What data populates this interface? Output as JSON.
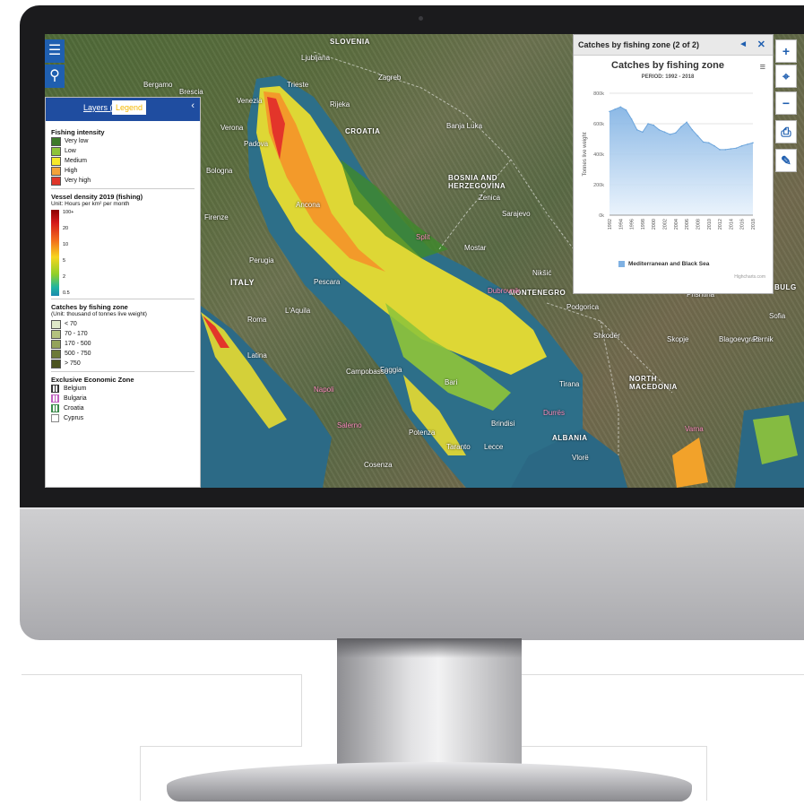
{
  "toolbar": {
    "menu_icon": "☰",
    "search_icon": "⚲"
  },
  "legend": {
    "tabs": {
      "layers": "Layers (8)",
      "legend": "Legend"
    },
    "collapse": "‹",
    "fishing_intensity": {
      "title": "Fishing intensity",
      "items": [
        {
          "label": "Very low",
          "color": "#3d7a2a"
        },
        {
          "label": "Low",
          "color": "#8fc43a"
        },
        {
          "label": "Medium",
          "color": "#f7ea2a"
        },
        {
          "label": "High",
          "color": "#f3a33a"
        },
        {
          "label": "Very high",
          "color": "#e0362a"
        }
      ]
    },
    "vessel_density": {
      "title": "Vessel density 2019 (fishing)",
      "unit": "Unit: Hours per km² per month",
      "ticks": [
        "100+",
        "20",
        "10",
        "5",
        "2",
        "0.5"
      ]
    },
    "catches": {
      "title": "Catches by fishing zone",
      "unit": "(Unit: thousand of tonnes live weight)",
      "items": [
        {
          "label": "< 70",
          "color": "#dfe8c8"
        },
        {
          "label": "70 - 170",
          "color": "#b4c27e"
        },
        {
          "label": "170 - 500",
          "color": "#94a35a"
        },
        {
          "label": "500 - 750",
          "color": "#6d7a38"
        },
        {
          "label": "> 750",
          "color": "#4c5420"
        }
      ]
    },
    "eez": {
      "title": "Exclusive Economic Zone",
      "items": [
        {
          "label": "Belgium",
          "color": "#333333"
        },
        {
          "label": "Bulgaria",
          "color": "#c060c0"
        },
        {
          "label": "Croatia",
          "color": "#3a8a4a"
        },
        {
          "label": "Cyprus",
          "color": "#888888"
        }
      ]
    }
  },
  "chart_panel": {
    "header": "Catches by fishing zone (2 of 2)",
    "nav": "◄",
    "close": "✕",
    "menu": "≡",
    "credit": "Highcharts.com"
  },
  "chart_data": {
    "type": "area",
    "title": "Catches by fishing zone",
    "subtitle": "PERIOD: 1992 - 2018",
    "ylabel": "Tonnes live weight",
    "ylim": [
      0,
      800000
    ],
    "yticks": [
      "0k",
      "200k",
      "400k",
      "600k",
      "800k"
    ],
    "x": [
      1992,
      1993,
      1994,
      1995,
      1996,
      1997,
      1998,
      1999,
      2000,
      2001,
      2002,
      2003,
      2004,
      2005,
      2006,
      2007,
      2008,
      2009,
      2010,
      2011,
      2012,
      2013,
      2014,
      2015,
      2016,
      2017,
      2018
    ],
    "xticks": [
      "1992",
      "1994",
      "1996",
      "1998",
      "2000",
      "2002",
      "2004",
      "2006",
      "2008",
      "2010",
      "2012",
      "2014",
      "2016",
      "2018"
    ],
    "series": [
      {
        "name": "Mediterranean and Black Sea",
        "values": [
          680000,
          695000,
          710000,
          690000,
          630000,
          560000,
          545000,
          600000,
          590000,
          560000,
          545000,
          530000,
          540000,
          580000,
          610000,
          560000,
          520000,
          480000,
          475000,
          455000,
          430000,
          430000,
          435000,
          440000,
          455000,
          465000,
          475000
        ]
      }
    ]
  },
  "controls": {
    "zoom_in": "+",
    "locate": "⌖",
    "zoom_out": "−",
    "print": "⎙",
    "measure": "✎"
  },
  "map_labels": {
    "countries": [
      "SLOVENIA",
      "CROATIA",
      "BOSNIA AND HERZEGOVINA",
      "MONTENEGRO",
      "ITALY",
      "ALBANIA",
      "NORTH MACEDONIA",
      "BULG"
    ],
    "cities": [
      "Ljubljana",
      "Zagreb",
      "Rijeka",
      "Sarajevo",
      "Podgorica",
      "Skopje",
      "Tirana",
      "Roma",
      "Napoli",
      "Bari",
      "Split",
      "Dubrovnik",
      "Ancona",
      "Pescara",
      "Perugia",
      "Firenze",
      "Bologna",
      "Venezia",
      "Trieste",
      "Foggia",
      "Durrës",
      "Prishtina",
      "Banja Luka",
      "Zenica",
      "Mostar",
      "Nikšić",
      "Taranto",
      "Potenza",
      "Cosenza",
      "Campobasso",
      "L'Aquila",
      "Bergamo",
      "Brescia",
      "Verona",
      "Padova",
      "Sofia",
      "Blagoevgrad",
      "Pernik",
      "Varna",
      "Vlorë",
      "Shkodër",
      "Latina",
      "Salerno",
      "Lecce",
      "Brindisi"
    ]
  }
}
